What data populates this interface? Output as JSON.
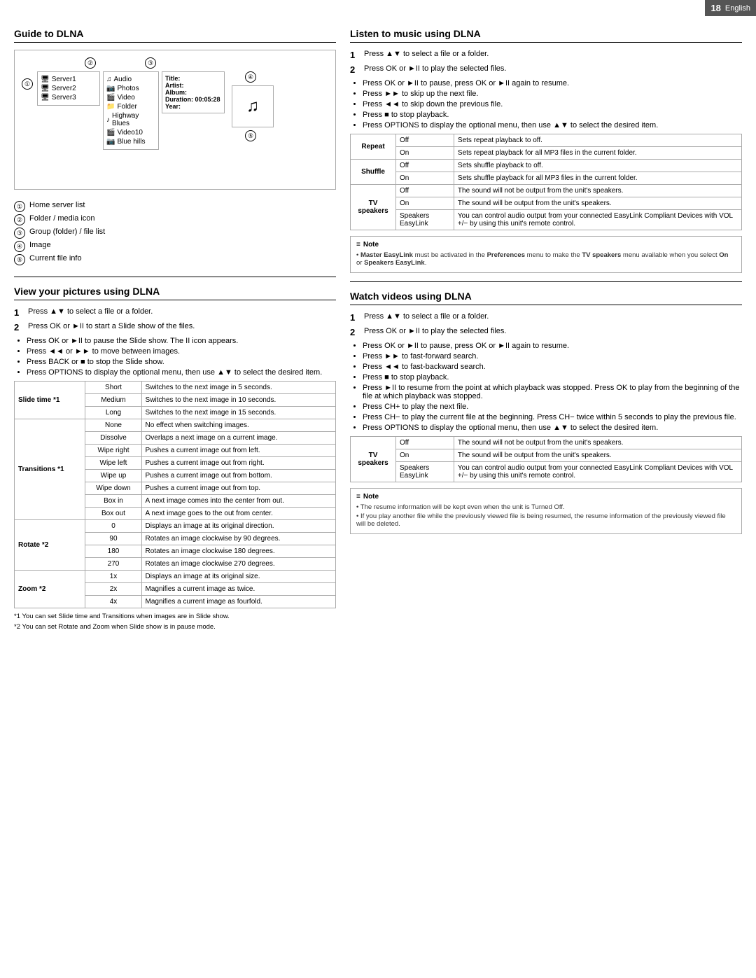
{
  "header": {
    "page_number": "18",
    "language": "English"
  },
  "left": {
    "guide_title": "Guide to DLNA",
    "diagram": {
      "numbers": [
        "②",
        "③",
        "①",
        "④",
        "⑤"
      ],
      "server_list": [
        "Server1",
        "Server2",
        "Server3"
      ],
      "folder_list": [
        "Audio",
        "Photos",
        "Video",
        "Folder",
        "Highway Blues",
        "Video10",
        "Blue hills"
      ],
      "info_block": {
        "title": "Title:",
        "artist": "Artist:",
        "album": "Album:",
        "duration": "Duration: 00:05:28",
        "year": "Year:"
      }
    },
    "legend": [
      {
        "num": "①",
        "text": "Home server list"
      },
      {
        "num": "②",
        "text": "Folder / media icon"
      },
      {
        "num": "③",
        "text": "Group (folder) / file list"
      },
      {
        "num": "④",
        "text": "Image"
      },
      {
        "num": "⑤",
        "text": "Current file info"
      }
    ],
    "view_pictures_title": "View your pictures using DLNA",
    "step1": "Press ▲▼ to select a file or a folder.",
    "step2": "Press OK or ►II to start a Slide show of the files.",
    "bullets": [
      "Press OK or ►II to pause the Slide show. The II icon appears.",
      "Press ◄◄ or ►► to move between images.",
      "Press BACK or ■ to stop the Slide show.",
      "Press OPTIONS to display the optional menu, then use ▲▼ to select the desired item."
    ],
    "table": {
      "slide_time_label": "Slide time *1",
      "slide_time_rows": [
        {
          "opt": "Short",
          "desc": "Switches to the next image in 5 seconds."
        },
        {
          "opt": "Medium",
          "desc": "Switches to the next image in 10 seconds."
        },
        {
          "opt": "Long",
          "desc": "Switches to the next image in 15 seconds."
        }
      ],
      "transitions_label": "Transitions *1",
      "transitions_rows": [
        {
          "opt": "None",
          "desc": "No effect when switching images."
        },
        {
          "opt": "Dissolve",
          "desc": "Overlaps a next image on a current image."
        },
        {
          "opt": "Wipe right",
          "desc": "Pushes a current image out from left."
        },
        {
          "opt": "Wipe left",
          "desc": "Pushes a current image out from right."
        },
        {
          "opt": "Wipe up",
          "desc": "Pushes a current image out from bottom."
        },
        {
          "opt": "Wipe down",
          "desc": "Pushes a current image out from top."
        },
        {
          "opt": "Box in",
          "desc": "A next image comes into the center from out."
        },
        {
          "opt": "Box out",
          "desc": "A next image goes to the out from center."
        }
      ],
      "rotate_label": "Rotate *2",
      "rotate_rows": [
        {
          "opt": "0",
          "desc": "Displays an image at its original direction."
        },
        {
          "opt": "90",
          "desc": "Rotates an image clockwise by 90 degrees."
        },
        {
          "opt": "180",
          "desc": "Rotates an image clockwise 180 degrees."
        },
        {
          "opt": "270",
          "desc": "Rotates an image clockwise 270 degrees."
        }
      ],
      "zoom_label": "Zoom *2",
      "zoom_rows": [
        {
          "opt": "1x",
          "desc": "Displays an image at its original size."
        },
        {
          "opt": "2x",
          "desc": "Magnifies a current image as twice."
        },
        {
          "opt": "4x",
          "desc": "Magnifies a current image as fourfold."
        }
      ]
    },
    "footnotes": [
      "*1 You can set Slide time and Transitions when images are in Slide show.",
      "*2 You can set Rotate and Zoom when Slide show is in pause mode."
    ]
  },
  "right": {
    "listen_title": "Listen to music using DLNA",
    "listen_step1": "Press ▲▼ to select a file or a folder.",
    "listen_step2": "Press OK or ►II to play the selected files.",
    "listen_bullets": [
      "Press OK or ►II to pause, press OK or ►II again to resume.",
      "Press ►► to skip up the next file.",
      "Press ◄◄ to skip down the previous file.",
      "Press ■ to stop playback.",
      "Press OPTIONS to display the optional menu, then use ▲▼ to select the desired item."
    ],
    "listen_table": {
      "repeat": {
        "label": "Repeat",
        "rows": [
          {
            "opt": "Off",
            "desc": "Sets repeat playback to off."
          },
          {
            "opt": "On",
            "desc": "Sets repeat playback for all MP3 files in the current folder."
          }
        ]
      },
      "shuffle": {
        "label": "Shuffle",
        "rows": [
          {
            "opt": "Off",
            "desc": "Sets shuffle playback to off."
          },
          {
            "opt": "On",
            "desc": "Sets shuffle playback for all MP3 files in the current folder."
          }
        ]
      },
      "tv_speakers": {
        "label": "TV speakers",
        "rows": [
          {
            "opt": "Off",
            "desc": "The sound will not be output from the unit's speakers."
          },
          {
            "opt": "On",
            "desc": "The sound will be output from the unit's speakers."
          },
          {
            "opt": "Speakers EasyLink",
            "desc": "You can control audio output from your connected EasyLink Compliant Devices with VOL +/− by using this unit's remote control."
          }
        ]
      }
    },
    "note1": {
      "header": "Note",
      "lines": [
        "Master EasyLink must be activated in the Preferences menu to make the TV speakers menu available when you select On or Speakers EasyLink."
      ]
    },
    "watch_title": "Watch videos using DLNA",
    "watch_step1": "Press ▲▼ to select a file or a folder.",
    "watch_step2": "Press OK or ►II to play the selected files.",
    "watch_bullets": [
      "Press OK or ►II to pause, press OK or ►II again to resume.",
      "Press ►► to fast-forward search.",
      "Press ◄◄ to fast-backward search.",
      "Press ■ to stop playback.",
      "Press ►II to resume from the point at which playback was stopped. Press OK to play from the beginning of the file at which playback was stopped.",
      "Press CH+ to play the next file.",
      "Press CH− to play the current file at the beginning. Press CH− twice within 5 seconds to play the previous file.",
      "Press OPTIONS to display the optional menu, then use ▲▼ to select the desired item."
    ],
    "watch_table": {
      "tv_speakers": {
        "label": "TV speakers",
        "rows": [
          {
            "opt": "Off",
            "desc": "The sound will not be output from the unit's speakers."
          },
          {
            "opt": "On",
            "desc": "The sound will be output from the unit's speakers."
          },
          {
            "opt": "Speakers EasyLink",
            "desc": "You can control audio output from your connected EasyLink Compliant Devices with VOL +/− by using this unit's remote control."
          }
        ]
      }
    },
    "note2": {
      "header": "Note",
      "lines": [
        "The resume information will be kept even when the unit is Turned Off.",
        "If you play another file while the previously viewed file is being resumed, the resume information of the previously viewed file will be deleted."
      ]
    }
  }
}
